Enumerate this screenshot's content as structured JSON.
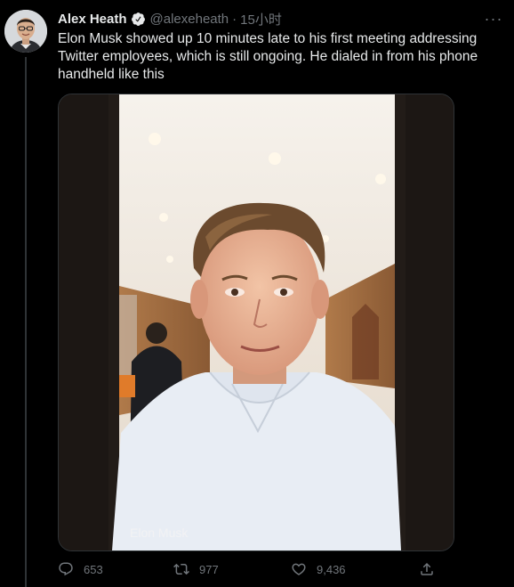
{
  "tweet": {
    "author_name": "Alex Heath",
    "handle": "@alexeheath",
    "separator": "·",
    "time": "15小时",
    "text": "Elon Musk showed up 10 minutes late to his first meeting addressing Twitter employees, which is still ongoing. He dialed in from his phone handheld like this",
    "media_caption": "Elon Musk",
    "more_label": "···"
  },
  "actions": {
    "replies": "653",
    "retweets": "977",
    "likes": "9,436"
  },
  "icons": {
    "verified": "verified-badge-icon",
    "reply": "reply-icon",
    "retweet": "retweet-icon",
    "like": "heart-icon",
    "share": "share-icon",
    "more": "more-icon"
  },
  "colors": {
    "background": "#000000",
    "text": "#e7e9ea",
    "muted": "#71767b",
    "divider": "#2f3336"
  }
}
